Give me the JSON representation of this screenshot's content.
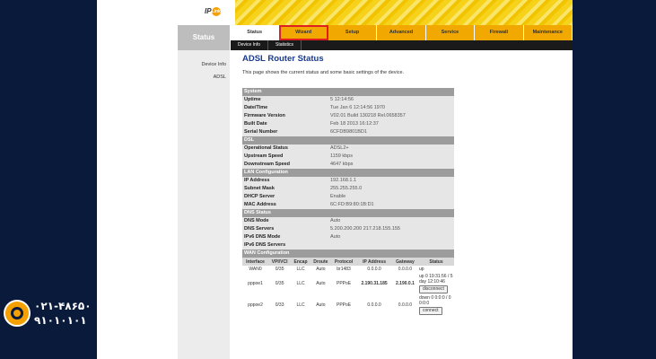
{
  "brand": {
    "logo_text": "IP",
    "logo_sub": "Link"
  },
  "side": {
    "header": "Status",
    "items": [
      "Device Info",
      "ADSL"
    ]
  },
  "tabs": [
    "Status",
    "Wizard",
    "Setup",
    "Advanced",
    "Service",
    "Firewall",
    "Maintenance"
  ],
  "subtabs": [
    "Device Info",
    "Statistics"
  ],
  "page": {
    "title": "ADSL Router Status",
    "description": "This page shows the current status and some basic settings of the device."
  },
  "sections": [
    {
      "title": "System",
      "rows": [
        {
          "key": "Uptime",
          "value": "5 12:14:56"
        },
        {
          "key": "Date/Time",
          "value": "Tue Jan 6 12:14:56 1970"
        },
        {
          "key": "Firmware Version",
          "value": "V02.01 Build 130218 Rel.0658357"
        },
        {
          "key": "Built Date",
          "value": "Feb 18 2013 16:12:37"
        },
        {
          "key": "Serial Number",
          "value": "6CFDB9801BD1"
        }
      ]
    },
    {
      "title": "DSL",
      "rows": [
        {
          "key": "Operational Status",
          "value": "ADSL2+"
        },
        {
          "key": "Upstream Speed",
          "value": "1159 kbps"
        },
        {
          "key": "Downstream Speed",
          "value": "4647 kbps"
        }
      ]
    },
    {
      "title": "LAN Configuration",
      "rows": [
        {
          "key": "IP Address",
          "value": "192.168.1.1"
        },
        {
          "key": "Subnet Mask",
          "value": "255.255.255.0"
        },
        {
          "key": "DHCP Server",
          "value": "Enable"
        },
        {
          "key": "MAC Address",
          "value": "6C:FD:B9:80:1B:D1"
        }
      ]
    },
    {
      "title": "DNS Status",
      "rows": [
        {
          "key": "DNS Mode",
          "value": "Auto"
        },
        {
          "key": "DNS Servers",
          "value": "5.200.200.200 217.218.155.155"
        },
        {
          "key": "IPv6 DNS Mode",
          "value": "Auto"
        },
        {
          "key": "IPv6 DNS Servers",
          "value": ""
        }
      ]
    }
  ],
  "wan": {
    "title": "WAN Configuration",
    "headers": [
      "Interface",
      "VPI/VCI",
      "Encap",
      "Droute",
      "Protocol",
      "IP Address",
      "Gateway",
      "Status"
    ],
    "rows": [
      {
        "cells": [
          "WAN0",
          "0/35",
          "LLC",
          "Auto",
          "br1483",
          "0.0.0.0",
          "0.0.0.0"
        ],
        "status": "up",
        "button": ""
      },
      {
        "cells": [
          "pppoe1",
          "0/35",
          "LLC",
          "Auto",
          "PPPoE",
          "2.190.31.185",
          "2.190.0.1"
        ],
        "status": "up 0 19:31:56 / 5 day 12:10:46",
        "button": "disconnect"
      },
      {
        "cells": [
          "pppoe2",
          "0/33",
          "LLC",
          "Auto",
          "PPPoE",
          "0.0.0.0",
          "0.0.0.0"
        ],
        "status": "down 0 0:0:0 / 0 0:0:0",
        "button": "connect"
      }
    ]
  },
  "contact": {
    "line1": "۰۲۱-۴۸۶۵۰",
    "line2": "۹۱۰۱۰۱۰۱"
  },
  "colors": {
    "accent": "#f1a800",
    "title": "#1a3a8c",
    "section": "#9c9c9c",
    "highlight": "#e02020"
  }
}
